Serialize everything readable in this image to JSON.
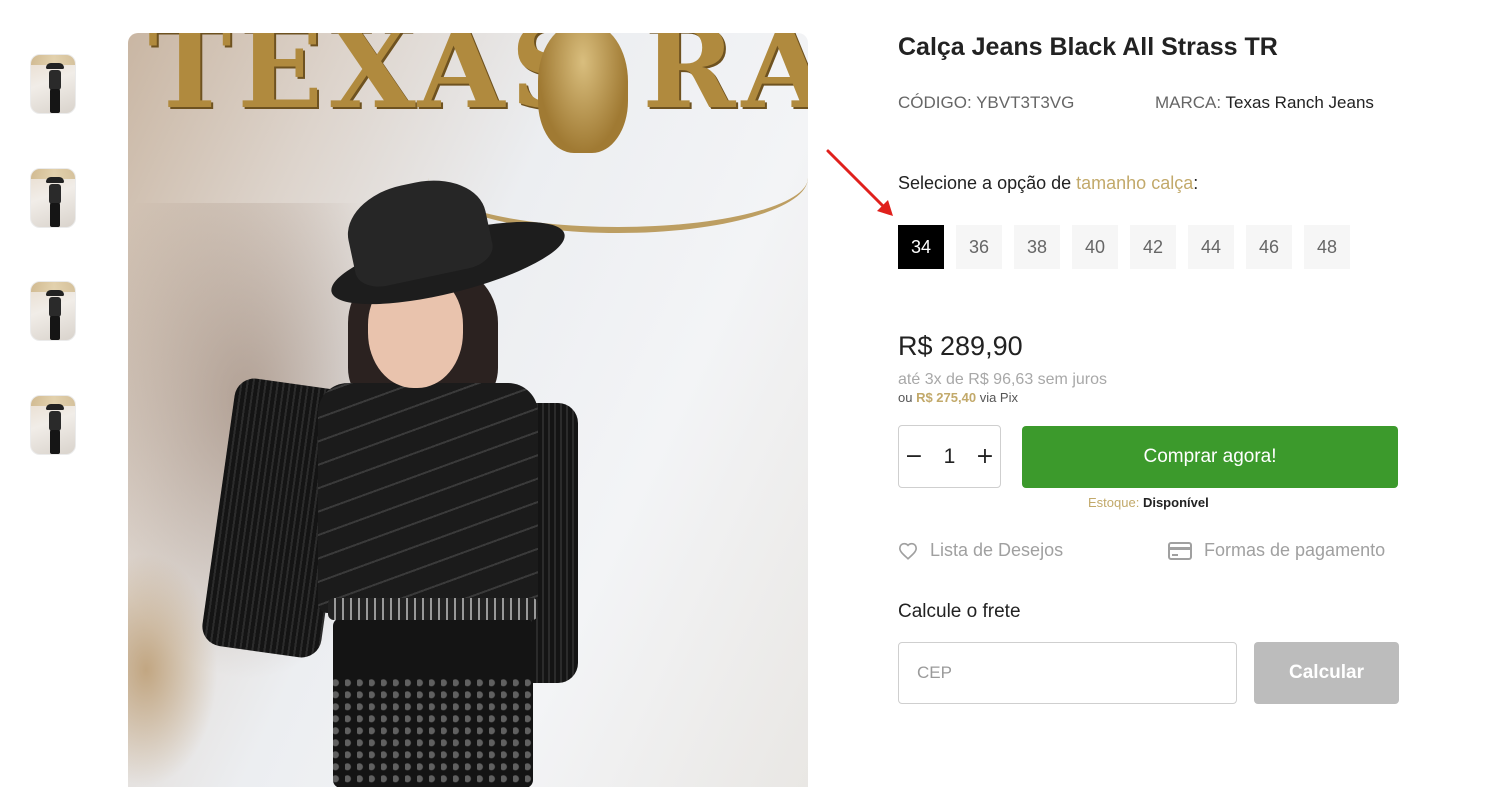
{
  "gallery": {
    "thumbnails": [
      {
        "alt": "product-thumbnail"
      },
      {
        "alt": "product-thumbnail"
      },
      {
        "alt": "product-thumbnail"
      },
      {
        "alt": "product-thumbnail"
      }
    ],
    "main_image_text": "TEXAS RAN"
  },
  "product": {
    "title": "Calça Jeans Black All Strass TR",
    "code_label": "CÓDIGO:",
    "code_value": "YBVT3T3VG",
    "brand_label": "MARCA:",
    "brand_value": "Texas Ranch Jeans"
  },
  "size_selector": {
    "prompt_prefix": "Selecione a opção de ",
    "prompt_accent": "tamanho calça",
    "prompt_suffix": ":",
    "options": [
      "34",
      "36",
      "38",
      "40",
      "42",
      "44",
      "46",
      "48"
    ],
    "selected": "34"
  },
  "pricing": {
    "price": "R$ 289,90",
    "installments": "até 3x de R$ 96,63 sem juros",
    "pix_prefix": "ou ",
    "pix_price": "R$ 275,40",
    "pix_suffix": " via Pix"
  },
  "purchase": {
    "quantity": "1",
    "minus_label": "−",
    "plus_label": "+",
    "buy_label": "Comprar agora!",
    "stock_label": "Estoque:",
    "stock_value": "Disponível"
  },
  "links": {
    "wishlist": "Lista de Desejos",
    "payment_methods": "Formas de pagamento"
  },
  "shipping": {
    "title": "Calcule o frete",
    "cep_placeholder": "CEP",
    "calculate_label": "Calcular"
  },
  "colors": {
    "accent_gold": "#c2a96a",
    "buy_green": "#3c9a2c",
    "selected_size": "#000000",
    "disabled_button": "#bcbcbc",
    "arrow_red": "#e0201c"
  },
  "icons": {
    "wishlist": "heart-icon",
    "payments": "credit-card-icon",
    "annotation": "red-arrow-icon"
  }
}
